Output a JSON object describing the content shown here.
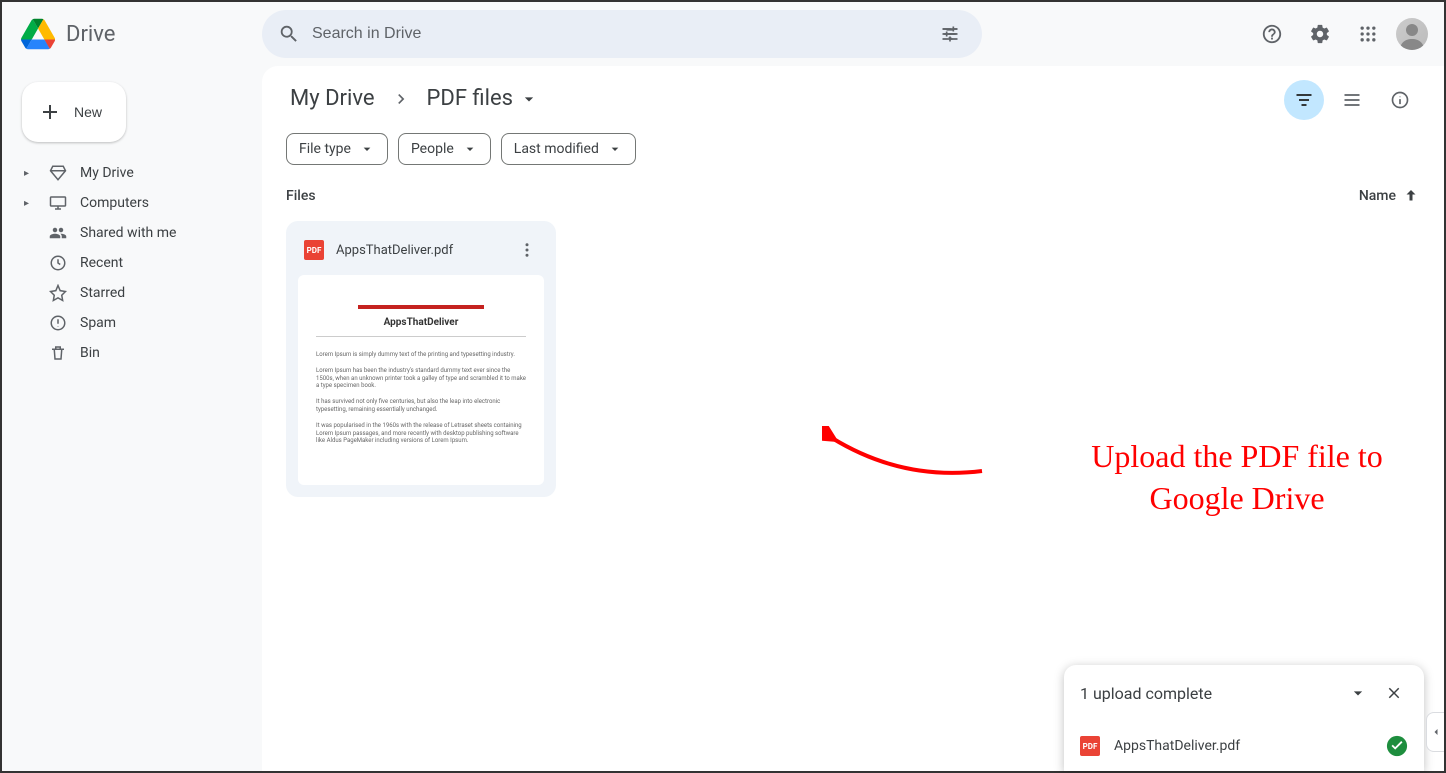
{
  "app": {
    "name": "Drive"
  },
  "search": {
    "placeholder": "Search in Drive"
  },
  "sidebar": {
    "new_label": "New",
    "items": [
      {
        "label": "My Drive"
      },
      {
        "label": "Computers"
      },
      {
        "label": "Shared with me"
      },
      {
        "label": "Recent"
      },
      {
        "label": "Starred"
      },
      {
        "label": "Spam"
      },
      {
        "label": "Bin"
      }
    ]
  },
  "breadcrumb": {
    "root": "My Drive",
    "current": "PDF files"
  },
  "filters": {
    "file_type": "File type",
    "people": "People",
    "last_modified": "Last modified"
  },
  "section": {
    "title": "Files",
    "sort": "Name"
  },
  "file": {
    "name": "AppsThatDeliver.pdf",
    "pdf_badge": "PDF",
    "thumb_title": "AppsThatDeliver",
    "thumb_p1": "Lorem Ipsum is simply dummy text of the printing and typesetting industry.",
    "thumb_p2": "Lorem Ipsum has been the industry's standard dummy text ever since the 1500s, when an unknown printer took a galley of type and scrambled it to make a type specimen book.",
    "thumb_p3": "It has survived not only five centuries, but also the leap into electronic typesetting, remaining essentially unchanged.",
    "thumb_p4": "It was popularised in the 1960s with the release of Letraset sheets containing Lorem Ipsum passages, and more recently with desktop publishing software like Aldus PageMaker including versions of Lorem Ipsum."
  },
  "upload": {
    "title": "1 upload complete",
    "file": "AppsThatDeliver.pdf"
  },
  "annotation": {
    "text1": "Upload the PDF file to",
    "text2": "Google Drive"
  }
}
